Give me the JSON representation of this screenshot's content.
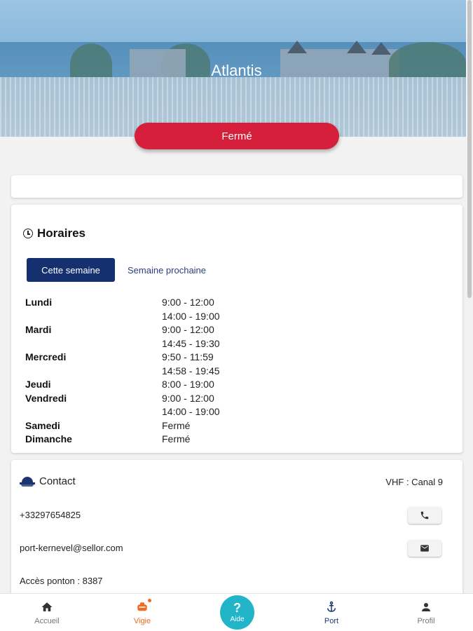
{
  "header": {
    "title": "Atlantis",
    "status_label": "Fermé",
    "status_color": "#d61f3a"
  },
  "hours": {
    "title": "Horaires",
    "tabs": [
      {
        "label": "Cette semaine",
        "active": true
      },
      {
        "label": "Semaine prochaine",
        "active": false
      }
    ],
    "days": [
      {
        "day": "Lundi",
        "slots": [
          "9:00 - 12:00",
          "14:00 - 19:00"
        ]
      },
      {
        "day": "Mardi",
        "slots": [
          "9:00 - 12:00",
          "14:45 - 19:30"
        ]
      },
      {
        "day": "Mercredi",
        "slots": [
          "9:50 - 11:59",
          "14:58 - 19:45"
        ]
      },
      {
        "day": "Jeudi",
        "slots": [
          "8:00 - 19:00"
        ]
      },
      {
        "day": "Vendredi",
        "slots": [
          "9:00 - 12:00",
          "14:00 - 19:00"
        ]
      },
      {
        "day": "Samedi",
        "slots": [
          "Fermé"
        ]
      },
      {
        "day": "Dimanche",
        "slots": [
          "Fermé"
        ]
      }
    ]
  },
  "contact": {
    "title": "Contact",
    "vhf": "VHF : Canal 9",
    "phone": "+33297654825",
    "email": "port-kernevel@sellor.com",
    "pontoon_access": "Accès ponton : 8387"
  },
  "nav": {
    "items": [
      {
        "label": "Accueil",
        "icon": "home-icon"
      },
      {
        "label": "Vigie",
        "icon": "lifebuoy-icon"
      },
      {
        "label": "Aide",
        "icon": "help-icon"
      },
      {
        "label": "Port",
        "icon": "anchor-icon"
      },
      {
        "label": "Profil",
        "icon": "person-icon"
      }
    ],
    "accent": "#f26a21",
    "aide_color": "#22b5c9",
    "brand": "#15306f"
  }
}
